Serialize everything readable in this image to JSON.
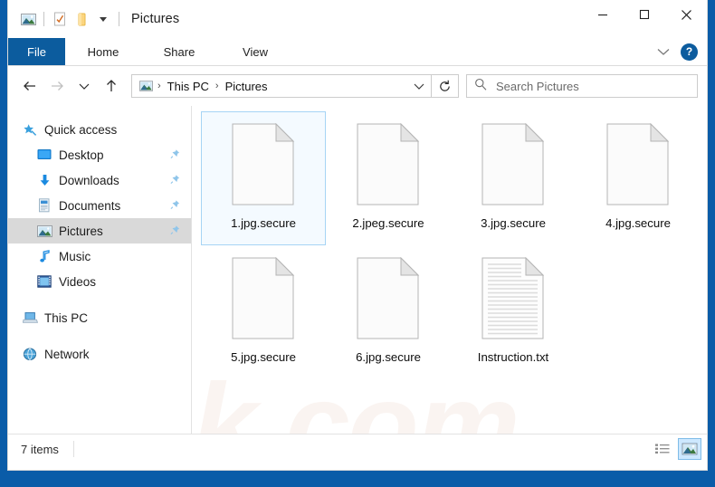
{
  "window": {
    "title": "Pictures",
    "quick_access_icons": [
      "picture-folder-icon",
      "properties-icon",
      "new-folder-icon",
      "customize-dropdown-icon"
    ],
    "controls": {
      "minimize": "minimize-icon",
      "maximize": "maximize-icon",
      "close": "close-icon"
    }
  },
  "ribbon": {
    "file_tab": "File",
    "tabs": [
      "Home",
      "Share",
      "View"
    ],
    "collapse_label": "chevron-down-icon",
    "help_label": "?"
  },
  "nav": {
    "back": "back-arrow-icon",
    "forward": "forward-arrow-icon",
    "recent": "chevron-down-icon",
    "up": "up-arrow-icon",
    "refresh": "refresh-icon",
    "breadcrumb_icon": "picture-folder-icon",
    "breadcrumbs": [
      "This PC",
      "Pictures"
    ],
    "separator": "›",
    "dropdown": "chevron-down-icon"
  },
  "search": {
    "icon": "search-icon",
    "placeholder": "Search Pictures",
    "value": ""
  },
  "sidebar": {
    "groups": [
      {
        "root": {
          "label": "Quick access",
          "icon": "star-pin-icon"
        },
        "items": [
          {
            "label": "Desktop",
            "icon": "desktop-icon",
            "pinned": true,
            "selected": false
          },
          {
            "label": "Downloads",
            "icon": "downloads-icon",
            "pinned": true,
            "selected": false
          },
          {
            "label": "Documents",
            "icon": "documents-icon",
            "pinned": true,
            "selected": false
          },
          {
            "label": "Pictures",
            "icon": "pictures-icon",
            "pinned": true,
            "selected": true
          },
          {
            "label": "Music",
            "icon": "music-icon",
            "pinned": false,
            "selected": false
          },
          {
            "label": "Videos",
            "icon": "videos-icon",
            "pinned": false,
            "selected": false
          }
        ]
      },
      {
        "root": {
          "label": "This PC",
          "icon": "this-pc-icon"
        },
        "items": []
      },
      {
        "root": {
          "label": "Network",
          "icon": "network-icon"
        },
        "items": []
      }
    ],
    "pin_icon": "pin-icon"
  },
  "files": [
    {
      "name": "1.jpg.secure",
      "icon": "blank-file-icon",
      "selected": true
    },
    {
      "name": "2.jpeg.secure",
      "icon": "blank-file-icon",
      "selected": false
    },
    {
      "name": "3.jpg.secure",
      "icon": "blank-file-icon",
      "selected": false
    },
    {
      "name": "4.jpg.secure",
      "icon": "blank-file-icon",
      "selected": false
    },
    {
      "name": "5.jpg.secure",
      "icon": "blank-file-icon",
      "selected": false
    },
    {
      "name": "6.jpg.secure",
      "icon": "blank-file-icon",
      "selected": false
    },
    {
      "name": "Instruction.txt",
      "icon": "text-file-icon",
      "selected": false
    }
  ],
  "watermark": "risk.com",
  "status": {
    "items_count": "7 items",
    "view_details": "details-view-icon",
    "view_large_icons": "large-icons-view-icon"
  },
  "colors": {
    "accent": "#0c5c9e",
    "frame": "#0a5ca8",
    "selection_fill": "#cde8ff",
    "selection_border": "#7fbce8",
    "sidebar_selected": "#d9d9d9"
  }
}
